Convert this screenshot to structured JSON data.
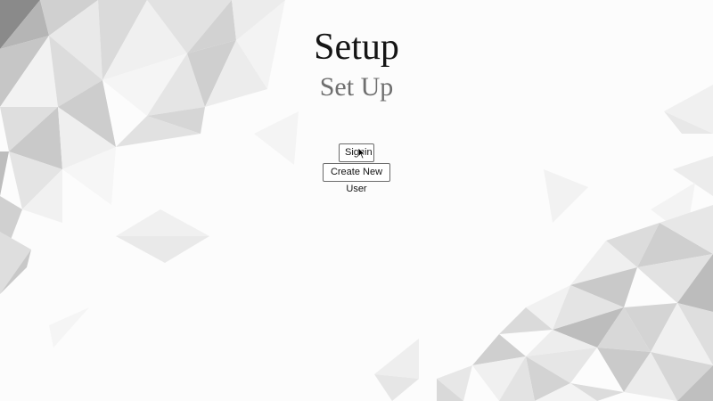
{
  "header": {
    "title": "Setup",
    "subtitle": "Set Up"
  },
  "actions": {
    "signin_label": "Signin",
    "create_user_label": "Create New User"
  },
  "background": {
    "pattern": "grey-triangles-icon"
  },
  "pointer": {
    "icon": "mouse-cursor-icon"
  }
}
